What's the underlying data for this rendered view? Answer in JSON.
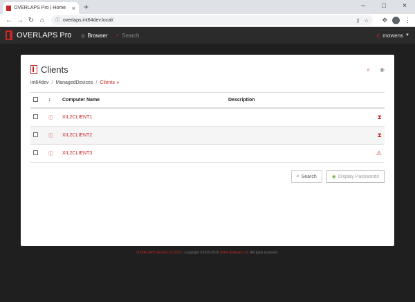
{
  "browser": {
    "tab_title": "OVERLAPS Pro | Home",
    "tab_close": "×",
    "new_tab": "+",
    "win_min": "–",
    "win_max": "□",
    "win_close": "×",
    "url": "overlaps.int64dev.local/"
  },
  "nav": {
    "brand": "OVERLAPS Pro",
    "browser_label": "Browser",
    "search_label": "Search",
    "user": "mowens"
  },
  "card": {
    "title": "Clients",
    "breadcrumb": [
      "int64dev",
      "ManagedDevices",
      "Clients"
    ],
    "breadcrumb_sep": "/"
  },
  "table": {
    "columns": [
      "",
      "",
      "Computer Name",
      "Description",
      ""
    ],
    "rows": [
      {
        "name": "XIL2CLIENT1",
        "description": "",
        "status_icon": "hourglass-icon"
      },
      {
        "name": "XIL2CLIENT2",
        "description": "",
        "status_icon": "hourglass-icon"
      },
      {
        "name": "XIL2CLIENT3",
        "description": "",
        "status_icon": "warning-icon"
      }
    ]
  },
  "buttons": {
    "search": "Search",
    "display_passwords": "Display Passwords"
  },
  "footer": {
    "version": "OVERLAPS Version 3.0.22.0",
    "copyright": " - Copyright ©2019-2020 ",
    "company": "Int64 Software Ltd",
    "rights": ". All rights reserved."
  },
  "colors": {
    "accent": "#c62828",
    "nav_bg": "#2b2b2b",
    "page_bg": "#1f1f1f"
  }
}
